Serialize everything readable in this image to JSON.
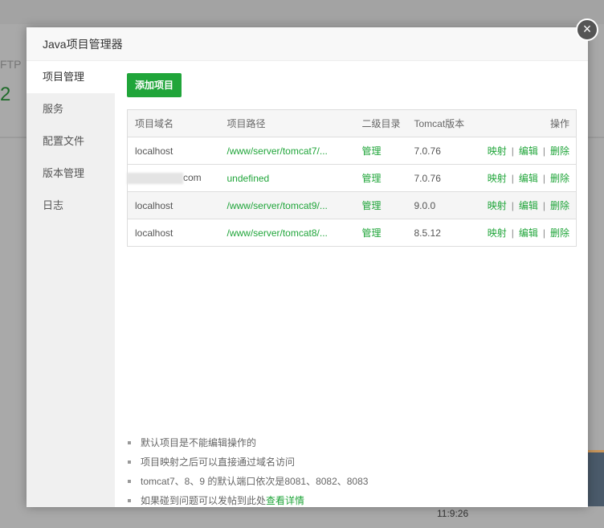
{
  "background": {
    "ftp_label": "FTP",
    "ftp_count": "2",
    "time": "11:9:26"
  },
  "dialog": {
    "title": "Java项目管理器",
    "close_icon": "×"
  },
  "sidebar": {
    "items": [
      {
        "label": "项目管理"
      },
      {
        "label": "服务"
      },
      {
        "label": "配置文件"
      },
      {
        "label": "版本管理"
      },
      {
        "label": "日志"
      }
    ]
  },
  "main": {
    "add_button": "添加项目",
    "columns": [
      "项目域名",
      "项目路径",
      "二级目录",
      "Tomcat版本",
      "操作"
    ],
    "rows": [
      {
        "domain": "localhost",
        "path": "/www/server/tomcat7/...",
        "subdir": "管理",
        "version": "7.0.76"
      },
      {
        "domain": "com",
        "path": "undefined",
        "subdir": "管理",
        "version": "7.0.76"
      },
      {
        "domain": "localhost",
        "path": "/www/server/tomcat9/...",
        "subdir": "管理",
        "version": "9.0.0"
      },
      {
        "domain": "localhost",
        "path": "/www/server/tomcat8/...",
        "subdir": "管理",
        "version": "8.5.12"
      }
    ],
    "actions": {
      "map": "映射",
      "edit": "编辑",
      "delete": "删除",
      "sep": "|"
    },
    "notes": [
      "默认项目是不能编辑操作的",
      "项目映射之后可以直接通过域名访问",
      "tomcat7、8、9 的默认端口依次是8081、8082、8083",
      "如果碰到问题可以发帖到此处"
    ],
    "notes_link": "查看详情"
  }
}
